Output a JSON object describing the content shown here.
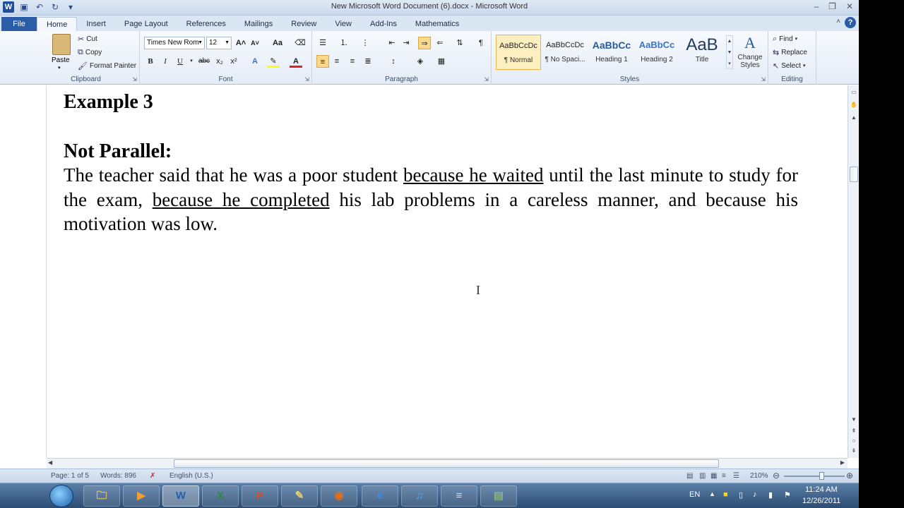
{
  "window": {
    "title": "New Microsoft Word Document (6).docx - Microsoft Word",
    "controls": [
      "–",
      "❐",
      "✕"
    ]
  },
  "quick_access": {
    "word_logo": "W",
    "save_icon": "save-icon",
    "undo_icon": "undo-icon",
    "redo_icon": "redo-icon",
    "customize_label": "▾"
  },
  "ribbon_tabs": [
    "File",
    "Home",
    "Insert",
    "Page Layout",
    "References",
    "Mailings",
    "Review",
    "View",
    "Add-Ins",
    "Mathematics"
  ],
  "active_tab": "Home",
  "clipboard": {
    "paste": "Paste",
    "cut": "Cut",
    "copy": "Copy",
    "format_painter": "Format Painter",
    "label": "Clipboard"
  },
  "font": {
    "family": "Times New Rom",
    "size": "12",
    "label": "Font",
    "buttons": [
      "B",
      "I",
      "U",
      "abc",
      "x₂",
      "x²"
    ],
    "grow": "A˄",
    "shrink": "A˅",
    "change_case": "Aa",
    "highlight_color": "#ffff00",
    "font_color": "#e02020"
  },
  "paragraph": {
    "label": "Paragraph",
    "pilcrow": "¶"
  },
  "styles": {
    "label": "Styles",
    "tiles": [
      {
        "sample": "AaBbCcDc",
        "name": "¶ Normal"
      },
      {
        "sample": "AaBbCcDc",
        "name": "¶ No Spaci..."
      },
      {
        "sample": "AaBbCc",
        "name": "Heading 1"
      },
      {
        "sample": "AaBbCc",
        "name": "Heading 2"
      },
      {
        "sample": "AaB",
        "name": "Title"
      }
    ],
    "change_styles_1": "Change",
    "change_styles_2": "Styles"
  },
  "editing": {
    "label": "Editing",
    "find": "Find",
    "replace": "Replace",
    "select": "Select"
  },
  "document": {
    "heading1": "Example 3",
    "heading2": "Not Parallel:",
    "para_1": "The teacher said that he was a poor student ",
    "para_u1": "because he waited",
    "para_2": " until the last minute to study for the exam, ",
    "para_u2": "because he completed",
    "para_3": " his lab problems in a careless manner, and because his motivation was low.",
    "cursor": "I"
  },
  "status_bar": {
    "page": "Page: 1 of 5",
    "words": "Words: 896",
    "language": "English (U.S.)",
    "zoom": "210%"
  },
  "taskbar": {
    "apps": [
      {
        "name": "explorer",
        "glyph": "🗀"
      },
      {
        "name": "media-player",
        "glyph": "▶"
      },
      {
        "name": "word",
        "glyph": "W"
      },
      {
        "name": "excel",
        "glyph": "X"
      },
      {
        "name": "powerpoint",
        "glyph": "P"
      },
      {
        "name": "sticky-folder",
        "glyph": "✎"
      },
      {
        "name": "firefox",
        "glyph": "◉"
      },
      {
        "name": "internet-explorer",
        "glyph": "e"
      },
      {
        "name": "itunes",
        "glyph": "♫"
      },
      {
        "name": "notepad",
        "glyph": "≡"
      },
      {
        "name": "misc-app",
        "glyph": "▤"
      }
    ],
    "lang": "EN",
    "time": "11:24 AM",
    "date": "12/26/2011"
  }
}
